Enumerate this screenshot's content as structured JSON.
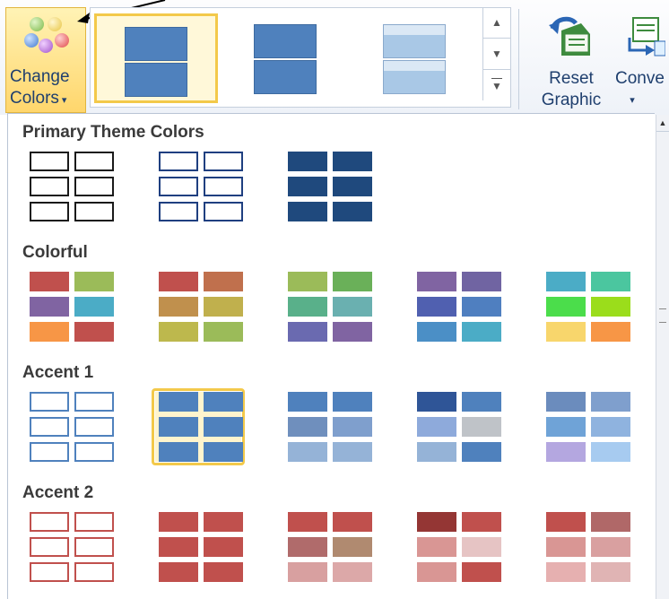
{
  "ribbon": {
    "change_colors_line1": "Change",
    "change_colors_line2": "Colors",
    "change_colors_caret": "▾",
    "reset_line1": "Reset",
    "reset_line2": "Graphic",
    "convert_line1": "Conve",
    "convert_caret": "▾",
    "icons": [
      "color-dots-icon",
      "reset-graphic-icon",
      "convert-icon",
      "scroll-up-icon",
      "scroll-down-icon",
      "more-icon"
    ],
    "scroll_up_glyph": "▲",
    "scroll_down_glyph": "▼",
    "more_glyph": "▼"
  },
  "sections": [
    {
      "title": "Primary Theme Colors",
      "swatches": [
        {
          "cells": [
            "outline:#1a1a1a",
            "outline:#1a1a1a",
            "outline:#1a1a1a",
            "outline:#1a1a1a",
            "outline:#1a1a1a",
            "outline:#1a1a1a"
          ]
        },
        {
          "cells": [
            "outline:#1f3f80",
            "outline:#1f3f80",
            "outline:#1f3f80",
            "outline:#1f3f80",
            "outline:#1f3f80",
            "outline:#1f3f80"
          ]
        },
        {
          "cells": [
            "#1f497d",
            "#1f497d",
            "#1f497d",
            "#1f497d",
            "#1f497d",
            "#1f497d"
          ]
        }
      ]
    },
    {
      "title": "Colorful",
      "swatches": [
        {
          "cells": [
            "#c0504d",
            "#9bbb59",
            "#8064a2",
            "#4bacc6",
            "#f79646",
            "#c0504d"
          ]
        },
        {
          "cells": [
            "#c0504d",
            "#c0704d",
            "#c0904d",
            "#c0b04d",
            "#bdb84d",
            "#9bbb59"
          ]
        },
        {
          "cells": [
            "#9bbb59",
            "#6ab059",
            "#59b08a",
            "#6ab0b0",
            "#6a6ab0",
            "#8064a2"
          ]
        },
        {
          "cells": [
            "#8064a2",
            "#7064a2",
            "#5060b0",
            "#4f7fc0",
            "#4b8fc6",
            "#4bacc6"
          ]
        },
        {
          "cells": [
            "#4bacc6",
            "#4bc69f",
            "#4bdd4b",
            "#9bdd1b",
            "#f8d66c",
            "#f79646"
          ]
        }
      ]
    },
    {
      "title": "Accent 1",
      "swatches": [
        {
          "cells": [
            "outline:#4f81bd",
            "outline:#4f81bd",
            "outline:#4f81bd",
            "outline:#4f81bd",
            "outline:#4f81bd",
            "outline:#4f81bd"
          ],
          "selected": false
        },
        {
          "cells": [
            "#4f81bd",
            "#4f81bd",
            "#4f81bd",
            "#4f81bd",
            "#4f81bd",
            "#4f81bd"
          ],
          "selected": true
        },
        {
          "cells": [
            "#4f81bd",
            "#4f81bd",
            "#6f8fbd",
            "#7f9fcd",
            "#95b3d7",
            "#95b3d7"
          ],
          "selected": false
        },
        {
          "cells": [
            "#2f5597",
            "#4f81bd",
            "#8eaadb",
            "#bfc3c8",
            "#95b3d7",
            "#4f81bd"
          ],
          "selected": false
        },
        {
          "cells": [
            "#6b8cbd",
            "#7f9fcd",
            "#6fa3d7",
            "#8fb3df",
            "#b4a7e0",
            "#a7cbf0"
          ],
          "selected": false
        }
      ]
    },
    {
      "title": "Accent 2",
      "swatches": [
        {
          "cells": [
            "outline:#c0504d",
            "outline:#c0504d",
            "outline:#c0504d",
            "outline:#c0504d",
            "outline:#c0504d",
            "outline:#c0504d"
          ]
        },
        {
          "cells": [
            "#c0504d",
            "#c0504d",
            "#c0504d",
            "#c0504d",
            "#c0504d",
            "#c0504d"
          ]
        },
        {
          "cells": [
            "#c0504d",
            "#c0504d",
            "#b06b6b",
            "#b08a70",
            "#d8a0a0",
            "#dca8a8"
          ]
        },
        {
          "cells": [
            "#943634",
            "#c0504d",
            "#d99694",
            "#e6c4c4",
            "#d99694",
            "#c0504d"
          ]
        },
        {
          "cells": [
            "#c0504d",
            "#b06868",
            "#d99694",
            "#d9a0a0",
            "#e6b0b0",
            "#e0b4b4"
          ]
        }
      ]
    }
  ]
}
